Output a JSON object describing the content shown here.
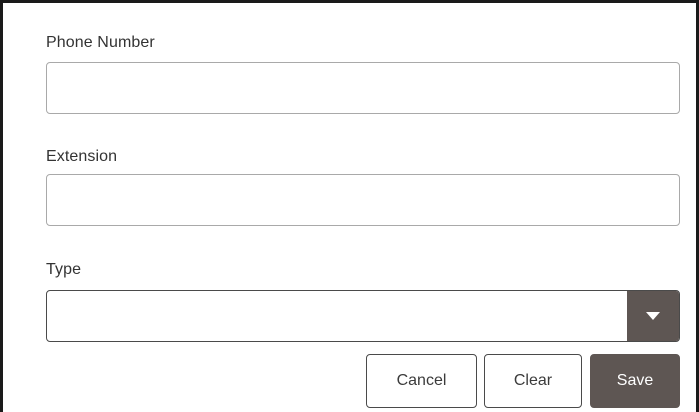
{
  "form": {
    "phone_number": {
      "label": "Phone Number",
      "value": "",
      "placeholder": ""
    },
    "extension": {
      "label": "Extension",
      "value": "",
      "placeholder": ""
    },
    "type": {
      "label": "Type",
      "selected": "",
      "toggle_icon": "caret-down-icon"
    }
  },
  "actions": {
    "cancel_label": "Cancel",
    "clear_label": "Clear",
    "save_label": "Save"
  },
  "colors": {
    "primary_button": "#5e5653",
    "border": "#a9a9a9",
    "frame": "#1a1a1a"
  }
}
